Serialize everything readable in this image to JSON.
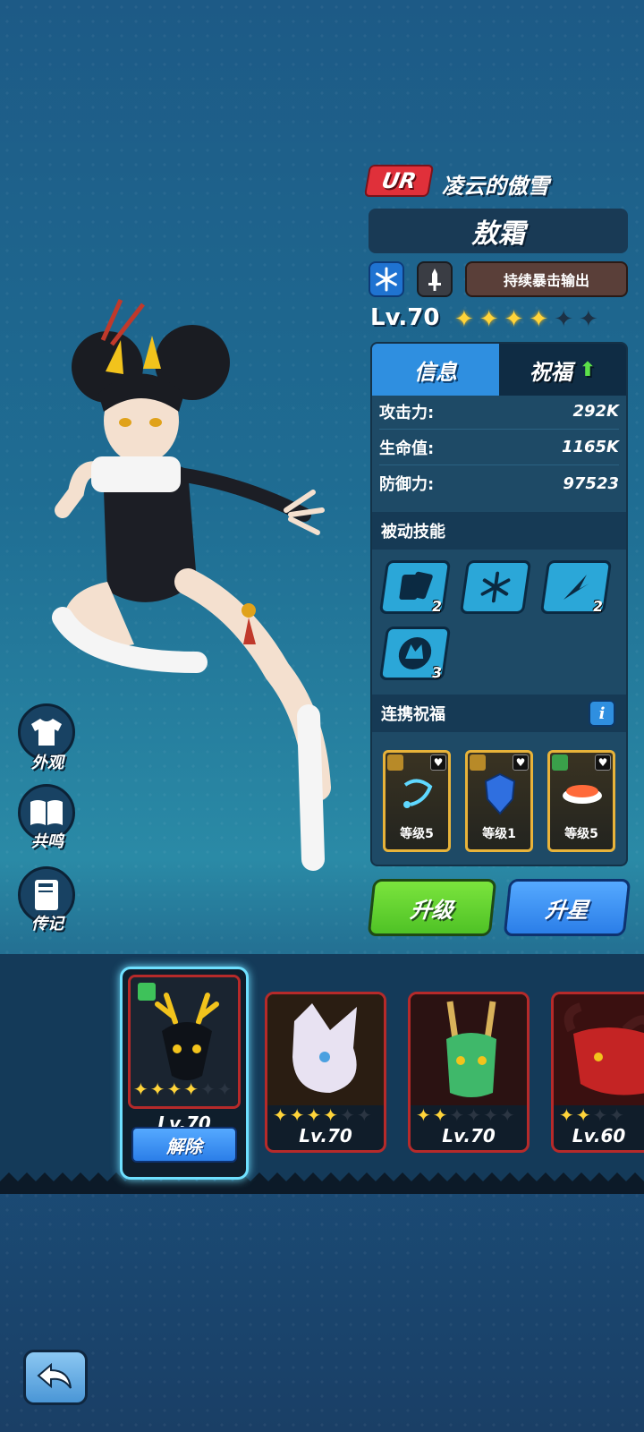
{
  "hero": {
    "rarity": "UR",
    "title": "凌云的傲雪",
    "name": "敖霜",
    "element_icon": "snowflake-icon",
    "weapon_icon": "sword-icon",
    "role_tag": "持续暴击输出",
    "level": "Lv.70",
    "stars": 4,
    "max_stars": 6
  },
  "tabs": {
    "info": "信息",
    "bless": "祝福"
  },
  "stats": [
    {
      "label": "攻击力:",
      "value": "292K"
    },
    {
      "label": "生命值:",
      "value": "1165K"
    },
    {
      "label": "防御力:",
      "value": "97523"
    }
  ],
  "passive": {
    "title": "被动技能",
    "skills": [
      {
        "icon": "cards-icon",
        "count": "2"
      },
      {
        "icon": "snowflake-icon",
        "count": ""
      },
      {
        "icon": "claw-slash-icon",
        "count": "2"
      },
      {
        "icon": "dragon-head-icon",
        "count": "3"
      }
    ]
  },
  "link_bless": {
    "title": "连携祝福",
    "info_label": "i",
    "cards": [
      {
        "icon": "bone-chain-icon",
        "level": "等级5"
      },
      {
        "icon": "blue-shield-icon",
        "level": "等级1"
      },
      {
        "icon": "sushi-icon",
        "level": "等级5"
      }
    ]
  },
  "buttons": {
    "upgrade": "升级",
    "star_up": "升星"
  },
  "side_menu": [
    {
      "icon": "shirt-icon",
      "label": "外观"
    },
    {
      "icon": "book-icon",
      "label": "共鸣"
    },
    {
      "icon": "journal-icon",
      "label": "传记"
    }
  ],
  "roster": [
    {
      "level": "Lv.70",
      "stars": 4,
      "max_stars": 6,
      "selected": true,
      "action": "解除",
      "portrait": "deer-spirit-icon"
    },
    {
      "level": "Lv.70",
      "stars": 4,
      "max_stars": 6,
      "selected": false,
      "portrait": "white-fox-icon"
    },
    {
      "level": "Lv.70",
      "stars": 2,
      "max_stars": 6,
      "selected": false,
      "portrait": "green-dragon-icon"
    },
    {
      "level": "Lv.60",
      "stars": 2,
      "max_stars": 6,
      "selected": false,
      "portrait": "red-demon-icon"
    }
  ],
  "colors": {
    "rarity_red": "#e0303a",
    "star_gold": "#ffd43a",
    "tab_blue": "#2f8fe0",
    "upgrade_green": "#4fc226",
    "card_border_red": "#b62a2a",
    "selected_glow": "#6fe0ff"
  }
}
